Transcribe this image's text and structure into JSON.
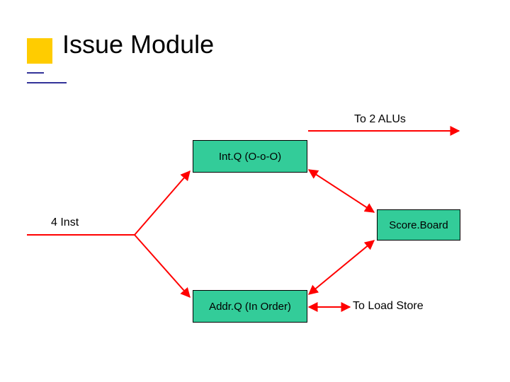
{
  "title": "Issue Module",
  "labels": {
    "to_alus": "To 2 ALUs",
    "four_inst": "4 Inst",
    "to_load_store": "To Load Store"
  },
  "boxes": {
    "intq": "Int.Q (O-o-O)",
    "scoreboard": "Score.Board",
    "addrq": "Addr.Q (In Order)"
  }
}
